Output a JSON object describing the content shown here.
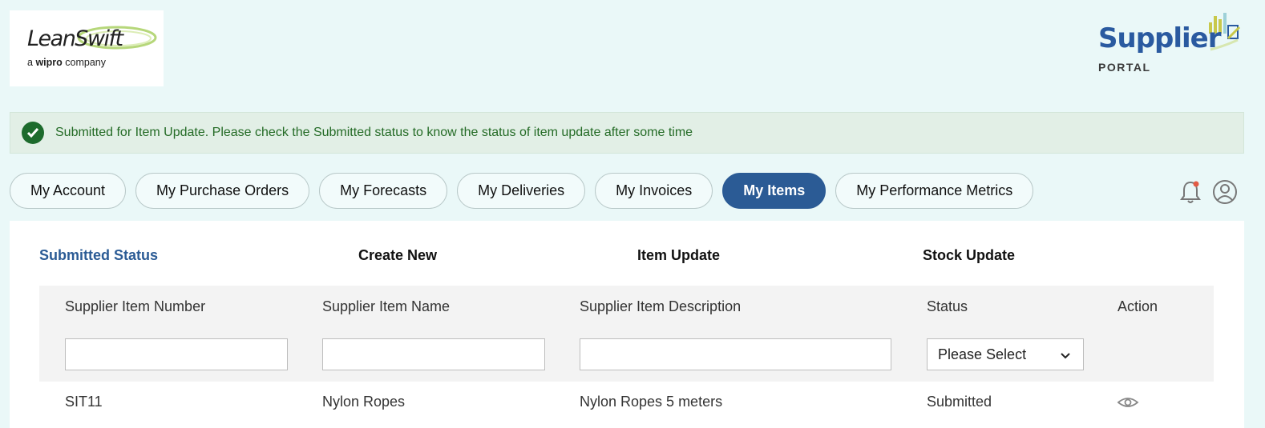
{
  "brand": {
    "company_name": "LeanSwift",
    "company_sub_prefix": "a",
    "company_sub_bold": "wipro",
    "company_sub_suffix": "company",
    "portal_title": "Supplier",
    "portal_subtitle": "PORTAL",
    "accent": "#2b5b95"
  },
  "alert": {
    "message": "Submitted for Item Update. Please check the Submitted status to know the status of item update after some time",
    "color": "#246b26",
    "icon": "check-circle-icon"
  },
  "tabs": [
    {
      "label": "My Account",
      "active": false
    },
    {
      "label": "My Purchase Orders",
      "active": false
    },
    {
      "label": "My Forecasts",
      "active": false
    },
    {
      "label": "My Deliveries",
      "active": false
    },
    {
      "label": "My Invoices",
      "active": false
    },
    {
      "label": "My Items",
      "active": true
    },
    {
      "label": "My Performance Metrics",
      "active": false
    }
  ],
  "header_icons": [
    "bell-icon",
    "user-icon"
  ],
  "subnav": {
    "submitted_status": "Submitted Status",
    "create_new": "Create New",
    "item_update": "Item Update",
    "stock_update": "Stock Update"
  },
  "table": {
    "columns": {
      "item_number": "Supplier Item Number",
      "item_name": "Supplier Item Name",
      "item_description": "Supplier Item Description",
      "status": "Status",
      "action": "Action"
    },
    "filters": {
      "item_number": "",
      "item_name": "",
      "item_description": "",
      "status_selected": "Please Select"
    },
    "rows": [
      {
        "item_number": "SIT11",
        "item_name": "Nylon Ropes",
        "item_description": "Nylon Ropes 5 meters",
        "status": "Submitted",
        "action_icon": "eye-icon"
      }
    ]
  }
}
